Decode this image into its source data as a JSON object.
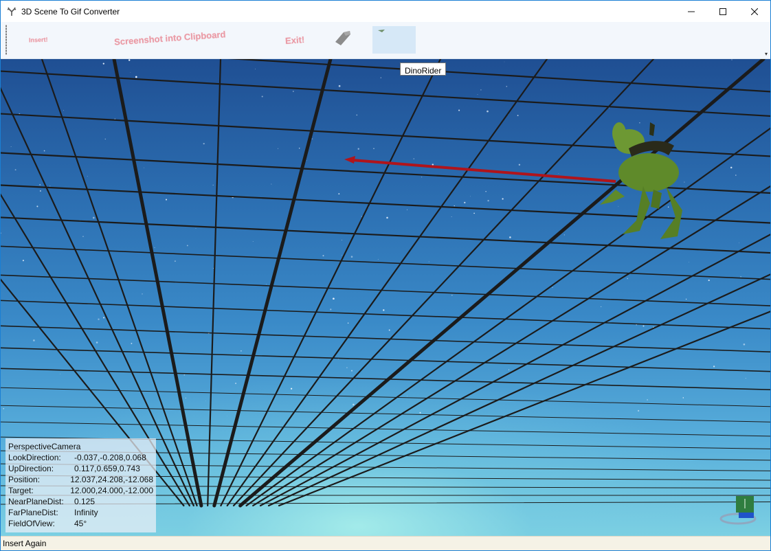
{
  "window": {
    "title": "3D Scene To Gif Converter",
    "controls": {
      "minimize": "—",
      "maximize": "☐",
      "close": "✕"
    },
    "icon": "antler-app-icon"
  },
  "toolbar": {
    "insert_label": "Insert!",
    "screenshot_label": "Screenshot into Clipboard",
    "exit_label": "Exit!",
    "tool_icon": "eraser-icon",
    "overflow": "▾"
  },
  "tooltip": {
    "text": "DinoRider"
  },
  "scene": {
    "model_name": "DinoRider",
    "colors": {
      "sky_top": "#1f4f93",
      "sky_bottom": "#7cd0e3",
      "grid": "#1b1b1b",
      "arrow": "#b0141b",
      "dino": "#6b8f2e"
    }
  },
  "camera_info": {
    "header": "PerspectiveCamera",
    "rows": [
      {
        "key": "LookDirection:",
        "value": "-0.037,-0.208,0.068"
      },
      {
        "key": "UpDirection:",
        "value": "0.117,0.659,0.743"
      },
      {
        "key": "Position:",
        "value": "12.037,24.208,-12.068"
      },
      {
        "key": "Target:",
        "value": "12.000,24.000,-12.000"
      },
      {
        "key": "NearPlaneDist:",
        "value": "0.125"
      },
      {
        "key": "FarPlaneDist:",
        "value": "Infinity"
      },
      {
        "key": "FieldOfView:",
        "value": "45°"
      }
    ]
  },
  "view_cube": {
    "icon": "view-cube-icon"
  },
  "status": {
    "text": "Insert Again"
  }
}
